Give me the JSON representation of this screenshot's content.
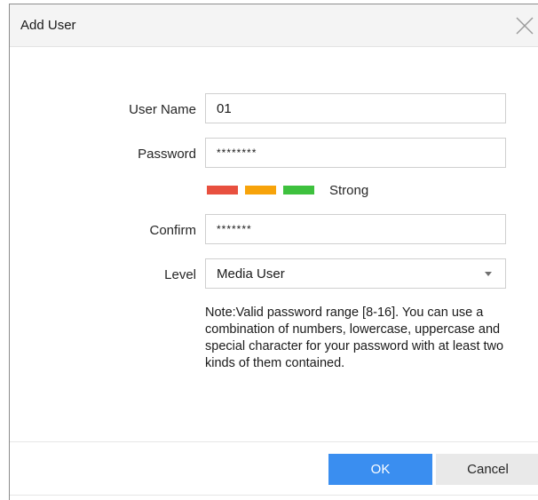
{
  "dialog": {
    "title": "Add User",
    "close_icon": "close-icon"
  },
  "form": {
    "user_name": {
      "label": "User Name",
      "value": "01"
    },
    "password": {
      "label": "Password",
      "value": "********"
    },
    "strength": {
      "label": "Strong",
      "colors": [
        "#e8503f",
        "#f7a30a",
        "#3ec13e"
      ]
    },
    "confirm": {
      "label": "Confirm",
      "value": "*******"
    },
    "level": {
      "label": "Level",
      "value": "Media User",
      "icon": "chevron-down-icon"
    },
    "note": "Note:Valid password range [8-16]. You can use a combination of numbers, lowercase, uppercase and special character for your password with at least two kinds of them contained."
  },
  "footer": {
    "ok_label": "OK",
    "cancel_label": "Cancel",
    "ok_color": "#3a8ef0"
  }
}
